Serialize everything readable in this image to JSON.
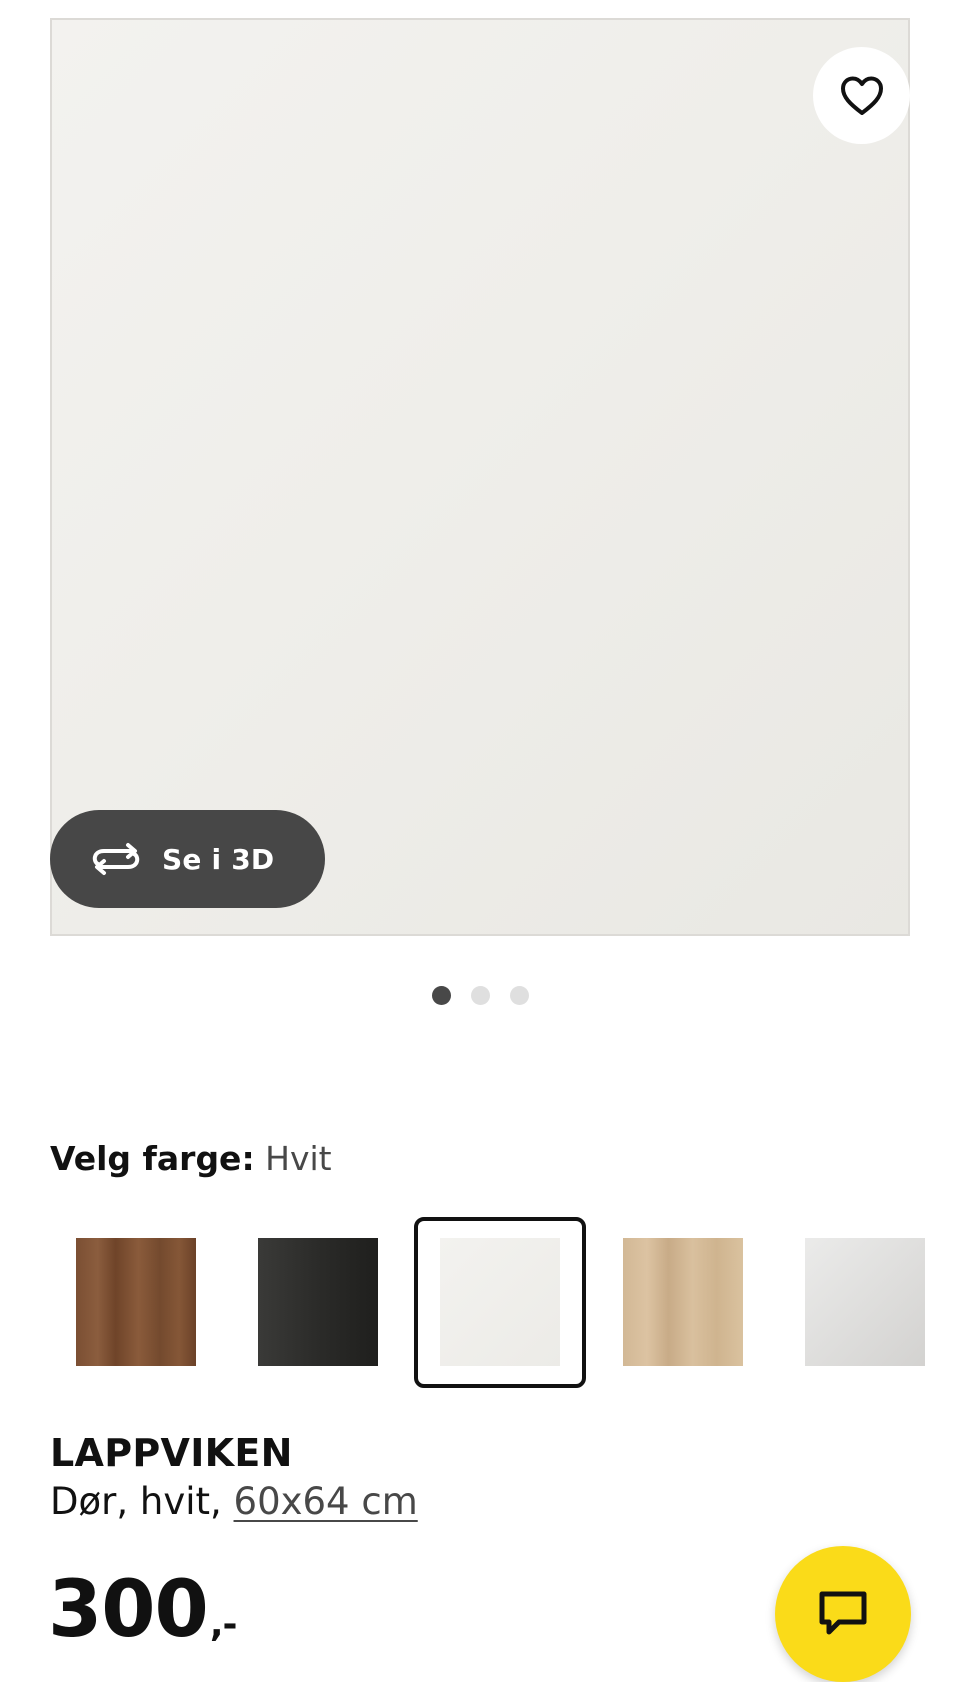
{
  "image_carousel": {
    "view3d_label": "Se i 3D",
    "active_slide": 1,
    "slide_count": 3
  },
  "color_selector": {
    "label": "Velg farge:",
    "selected_value": "Hvit",
    "swatches": [
      {
        "name": "walnut",
        "color": "#7b4f33",
        "selected": false
      },
      {
        "name": "black",
        "color": "#2b2b29",
        "selected": false
      },
      {
        "name": "white",
        "color": "#efeeea",
        "selected": true
      },
      {
        "name": "oak",
        "color": "#d2b895",
        "selected": false
      },
      {
        "name": "light-grey",
        "color": "#dfdedc",
        "selected": false
      }
    ]
  },
  "product": {
    "name": "LAPPVIKEN",
    "description_prefix": "Dør, hvit, ",
    "size_link": "60x64 cm",
    "price": "300",
    "price_suffix": ",-"
  },
  "colors": {
    "accent_yellow": "#fadb19",
    "dark_button": "#474747",
    "text": "#111111"
  },
  "icons": {
    "favourite": "heart-icon",
    "view3d": "rotate-3d-icon",
    "chat": "chat-bubble-icon"
  }
}
